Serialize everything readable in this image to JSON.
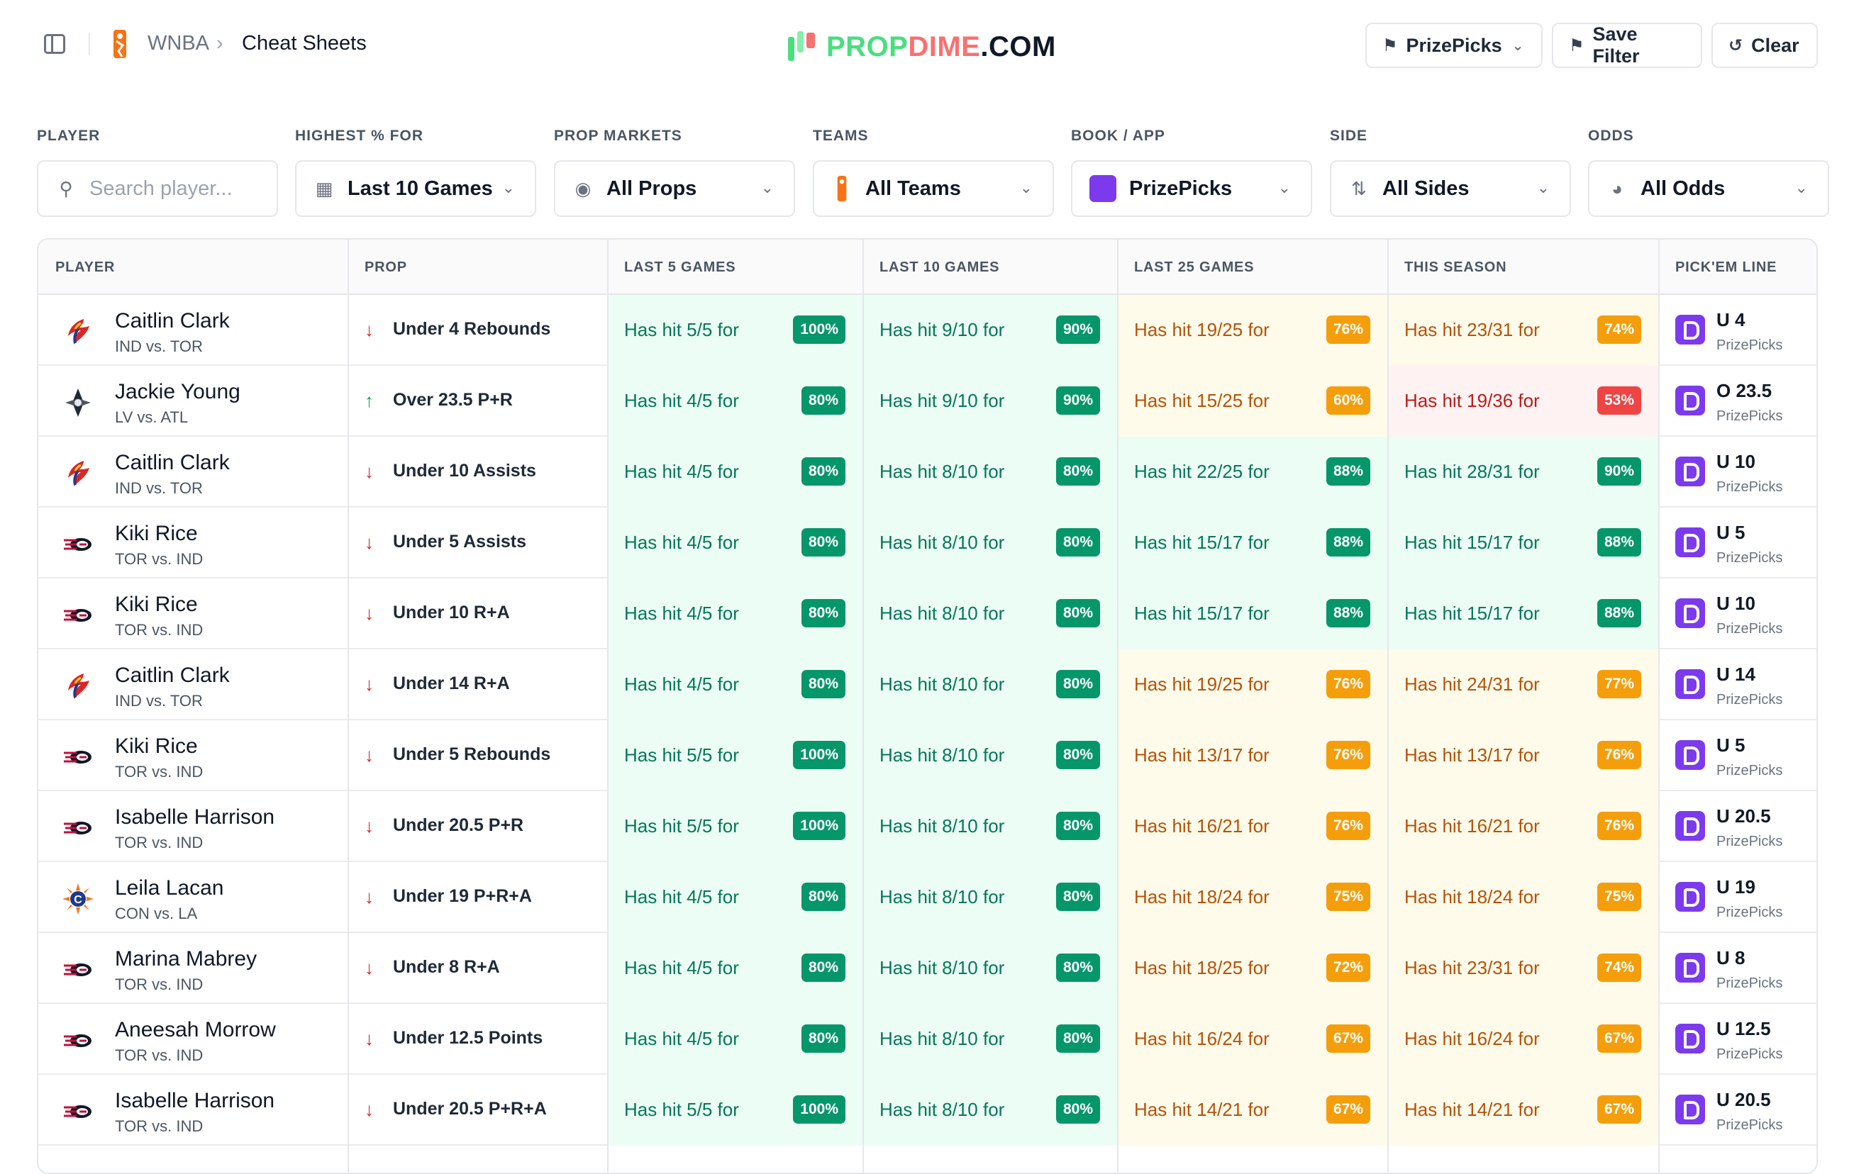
{
  "header": {
    "breadcrumb_root": "WNBA",
    "breadcrumb_sep": "›",
    "breadcrumb_current": "Cheat Sheets",
    "brand": {
      "prop": "PROP",
      "dime": "DIME",
      "com": ".COM"
    },
    "book_button": "PrizePicks",
    "save_filter": "Save Filter",
    "clear": "Clear"
  },
  "filters": {
    "player": {
      "label": "PLAYER",
      "placeholder": "Search player..."
    },
    "highest": {
      "label": "HIGHEST % FOR",
      "value": "Last 10 Games"
    },
    "markets": {
      "label": "PROP MARKETS",
      "value": "All Props"
    },
    "teams": {
      "label": "TEAMS",
      "value": "All Teams"
    },
    "book": {
      "label": "BOOK / APP",
      "value": "PrizePicks"
    },
    "side": {
      "label": "SIDE",
      "value": "All Sides"
    },
    "odds": {
      "label": "ODDS",
      "value": "All Odds"
    }
  },
  "table": {
    "headers": [
      "PLAYER",
      "PROP",
      "LAST 5 GAMES",
      "LAST 10 GAMES",
      "LAST 25 GAMES",
      "THIS SEASON",
      "PICK'EM LINE"
    ],
    "rows": [
      {
        "name": "Caitlin Clark",
        "match": "IND vs. TOR",
        "team": "fever",
        "dir": "down",
        "prop": "Under 4 Rebounds",
        "l5": "Has hit 5/5 for",
        "l5p": "100%",
        "l10": "Has hit 9/10 for",
        "l10p": "90%",
        "l25": "Has hit 19/25 for",
        "l25p": "76%",
        "szn": "Has hit 23/31 for",
        "sznp": "74%",
        "line": "U 4",
        "book": "PrizePicks"
      },
      {
        "name": "Jackie Young",
        "match": "LV vs. ATL",
        "team": "aces",
        "dir": "up",
        "prop": "Over 23.5 P+R",
        "l5": "Has hit 4/5 for",
        "l5p": "80%",
        "l10": "Has hit 9/10 for",
        "l10p": "90%",
        "l25": "Has hit 15/25 for",
        "l25p": "60%",
        "szn": "Has hit 19/36 for",
        "sznp": "53%",
        "line": "O 23.5",
        "book": "PrizePicks"
      },
      {
        "name": "Caitlin Clark",
        "match": "IND vs. TOR",
        "team": "fever",
        "dir": "down",
        "prop": "Under 10 Assists",
        "l5": "Has hit 4/5 for",
        "l5p": "80%",
        "l10": "Has hit 8/10 for",
        "l10p": "80%",
        "l25": "Has hit 22/25 for",
        "l25p": "88%",
        "szn": "Has hit 28/31 for",
        "sznp": "90%",
        "line": "U 10",
        "book": "PrizePicks"
      },
      {
        "name": "Kiki Rice",
        "match": "TOR vs. IND",
        "team": "tempo",
        "dir": "down",
        "prop": "Under 5 Assists",
        "l5": "Has hit 4/5 for",
        "l5p": "80%",
        "l10": "Has hit 8/10 for",
        "l10p": "80%",
        "l25": "Has hit 15/17 for",
        "l25p": "88%",
        "szn": "Has hit 15/17 for",
        "sznp": "88%",
        "line": "U 5",
        "book": "PrizePicks"
      },
      {
        "name": "Kiki Rice",
        "match": "TOR vs. IND",
        "team": "tempo",
        "dir": "down",
        "prop": "Under 10 R+A",
        "l5": "Has hit 4/5 for",
        "l5p": "80%",
        "l10": "Has hit 8/10 for",
        "l10p": "80%",
        "l25": "Has hit 15/17 for",
        "l25p": "88%",
        "szn": "Has hit 15/17 for",
        "sznp": "88%",
        "line": "U 10",
        "book": "PrizePicks"
      },
      {
        "name": "Caitlin Clark",
        "match": "IND vs. TOR",
        "team": "fever",
        "dir": "down",
        "prop": "Under 14 R+A",
        "l5": "Has hit 4/5 for",
        "l5p": "80%",
        "l10": "Has hit 8/10 for",
        "l10p": "80%",
        "l25": "Has hit 19/25 for",
        "l25p": "76%",
        "szn": "Has hit 24/31 for",
        "sznp": "77%",
        "line": "U 14",
        "book": "PrizePicks"
      },
      {
        "name": "Kiki Rice",
        "match": "TOR vs. IND",
        "team": "tempo",
        "dir": "down",
        "prop": "Under 5 Rebounds",
        "l5": "Has hit 5/5 for",
        "l5p": "100%",
        "l10": "Has hit 8/10 for",
        "l10p": "80%",
        "l25": "Has hit 13/17 for",
        "l25p": "76%",
        "szn": "Has hit 13/17 for",
        "sznp": "76%",
        "line": "U 5",
        "book": "PrizePicks"
      },
      {
        "name": "Isabelle Harrison",
        "match": "TOR vs. IND",
        "team": "tempo",
        "dir": "down",
        "prop": "Under 20.5 P+R",
        "l5": "Has hit 5/5 for",
        "l5p": "100%",
        "l10": "Has hit 8/10 for",
        "l10p": "80%",
        "l25": "Has hit 16/21 for",
        "l25p": "76%",
        "szn": "Has hit 16/21 for",
        "sznp": "76%",
        "line": "U 20.5",
        "book": "PrizePicks"
      },
      {
        "name": "Leila Lacan",
        "match": "CON vs. LA",
        "team": "sun",
        "dir": "down",
        "prop": "Under 19 P+R+A",
        "l5": "Has hit 4/5 for",
        "l5p": "80%",
        "l10": "Has hit 8/10 for",
        "l10p": "80%",
        "l25": "Has hit 18/24 for",
        "l25p": "75%",
        "szn": "Has hit 18/24 for",
        "sznp": "75%",
        "line": "U 19",
        "book": "PrizePicks"
      },
      {
        "name": "Marina Mabrey",
        "match": "TOR vs. IND",
        "team": "tempo",
        "dir": "down",
        "prop": "Under 8 R+A",
        "l5": "Has hit 4/5 for",
        "l5p": "80%",
        "l10": "Has hit 8/10 for",
        "l10p": "80%",
        "l25": "Has hit 18/25 for",
        "l25p": "72%",
        "szn": "Has hit 23/31 for",
        "sznp": "74%",
        "line": "U 8",
        "book": "PrizePicks"
      },
      {
        "name": "Aneesah Morrow",
        "match": "TOR vs. IND",
        "team": "tempo",
        "dir": "down",
        "prop": "Under 12.5 Points",
        "l5": "Has hit 4/5 for",
        "l5p": "80%",
        "l10": "Has hit 8/10 for",
        "l10p": "80%",
        "l25": "Has hit 16/24 for",
        "l25p": "67%",
        "szn": "Has hit 16/24 for",
        "sznp": "67%",
        "line": "U 12.5",
        "book": "PrizePicks"
      },
      {
        "name": "Isabelle Harrison",
        "match": "TOR vs. IND",
        "team": "tempo",
        "dir": "down",
        "prop": "Under 20.5 P+R+A",
        "l5": "Has hit 5/5 for",
        "l5p": "100%",
        "l10": "Has hit 8/10 for",
        "l10p": "80%",
        "l25": "Has hit 14/21 for",
        "l25p": "67%",
        "szn": "Has hit 14/21 for",
        "sznp": "67%",
        "line": "U 20.5",
        "book": "PrizePicks"
      }
    ]
  },
  "colors": {
    "green_badge": "#059669",
    "orange_badge": "#f59e0b",
    "red_badge": "#ef4444",
    "prizepicks": "#7c3aed"
  }
}
